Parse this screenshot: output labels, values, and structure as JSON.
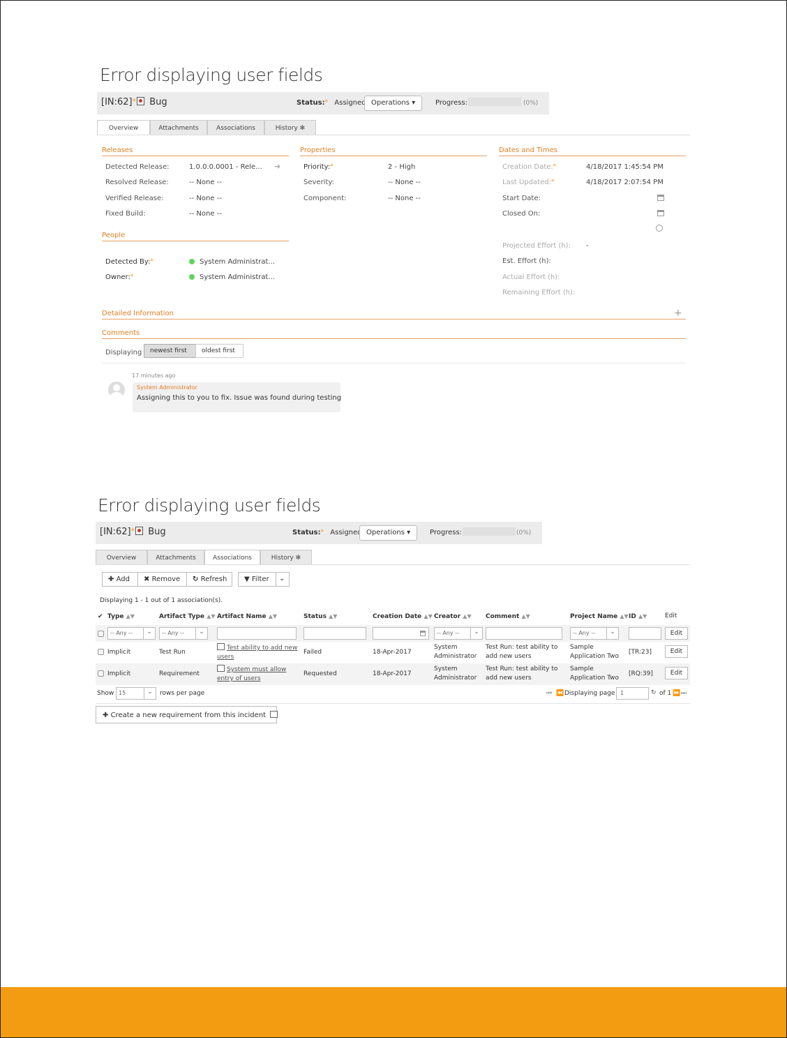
{
  "screen1": {
    "page_title": "Error displaying user fields",
    "header": {
      "id": "[IN:62]",
      "name": "Bug",
      "status_label": "Status:",
      "status_value": "Assigned",
      "operations_label": "Operations ▾",
      "progress_label": "Progress:",
      "progress_pct": "(0%)",
      "progress_value": 0
    },
    "tabs": [
      "Overview",
      "Attachments",
      "Associations",
      "History ✻"
    ],
    "releases": {
      "heading": "Releases",
      "rows": [
        {
          "label": "Detected Release:",
          "value": "1.0.0.0.0001 - Rele..."
        },
        {
          "label": "Resolved Release:",
          "value": "-- None --"
        },
        {
          "label": "Verified Release:",
          "value": "-- None --"
        },
        {
          "label": "Fixed Build:",
          "value": "-- None --"
        }
      ]
    },
    "properties": {
      "heading": "Properties",
      "rows": [
        {
          "label": "Priority:",
          "value": "2 - High"
        },
        {
          "label": "Severity:",
          "value": "-- None --"
        },
        {
          "label": "Component:",
          "value": "-- None --"
        }
      ]
    },
    "dates": {
      "heading": "Dates and Times",
      "rows": [
        {
          "label": "Creation Date:",
          "value": "4/18/2017 1:45:54 PM"
        },
        {
          "label": "Last Updated:",
          "value": "4/18/2017 2:07:54 PM"
        },
        {
          "label": "Start Date:",
          "value": ""
        },
        {
          "label": "Closed On:",
          "value": ""
        }
      ],
      "effort": [
        {
          "label": "Projected Effort (h):",
          "value": "-"
        },
        {
          "label": "Est. Effort (h):",
          "value": ""
        },
        {
          "label": "Actual Effort (h):",
          "value": ""
        },
        {
          "label": "Remaining Effort (h):",
          "value": ""
        }
      ]
    },
    "people": {
      "heading": "People",
      "rows": [
        {
          "label": "Detected By:",
          "value": "System Administrat..."
        },
        {
          "label": "Owner:",
          "value": "System Administrat..."
        }
      ]
    },
    "detailed_heading": "Detailed Information",
    "comments": {
      "heading": "Comments",
      "displaying_label": "Displaying",
      "newest_label": "newest first",
      "oldest_label": "oldest first",
      "time": "17 minutes ago",
      "author": "System Administrator",
      "text": "Assigning this to you to fix. Issue was found during testing"
    }
  },
  "screen2": {
    "page_title": "Error displaying user fields",
    "header": {
      "id": "[IN:62]",
      "name": "Bug",
      "status_label": "Status:",
      "status_value": "Assigned",
      "operations_label": "Operations ▾",
      "progress_label": "Progress:",
      "progress_pct": "(0%)",
      "progress_value": 0
    },
    "tabs": [
      "Overview",
      "Attachments",
      "Associations",
      "History ✻"
    ],
    "toolbar": {
      "add": "Add",
      "remove": "Remove",
      "refresh": "Refresh",
      "filter": "Filter"
    },
    "displaying_text": "Displaying 1 - 1 out of 1 association(s).",
    "columns": [
      "Type",
      "Artifact Type",
      "Artifact Name",
      "Status",
      "Creation Date",
      "Creator",
      "Comment",
      "Project Name",
      "ID",
      "Edit"
    ],
    "filter_any": "-- Any --",
    "edit_label": "Edit",
    "rows": [
      {
        "type": "Implicit",
        "artifact_type": "Test Run",
        "artifact_name_1": "Test ability to add new",
        "artifact_name_2": "users",
        "status": "Failed",
        "creation_date": "18-Apr-2017",
        "creator_1": "System",
        "creator_2": "Administrator",
        "comment_1": "Test Run: test ability to",
        "comment_2": "add new users",
        "project_1": "Sample",
        "project_2": "Application Two",
        "id": "[TR:23]"
      },
      {
        "type": "Implicit",
        "artifact_type": "Requirement",
        "artifact_name_1": "System must allow",
        "artifact_name_2": "entry of users",
        "status": "Requested",
        "creation_date": "18-Apr-2017",
        "creator_1": "System",
        "creator_2": "Administrator",
        "comment_1": "Test Run: test ability to",
        "comment_2": "add new users",
        "project_1": "Sample",
        "project_2": "Application Two",
        "id": "[RQ:39]"
      }
    ],
    "pager": {
      "show_label": "Show",
      "rows_value": "15",
      "rows_label": "rows per page",
      "displaying_page": "Displaying page",
      "page_value": "1",
      "of_label": "of 1"
    },
    "create_req_label": "Create a new requirement from this incident"
  },
  "colors": {
    "accent": "#f39c12",
    "section_heading": "#e67e22"
  }
}
